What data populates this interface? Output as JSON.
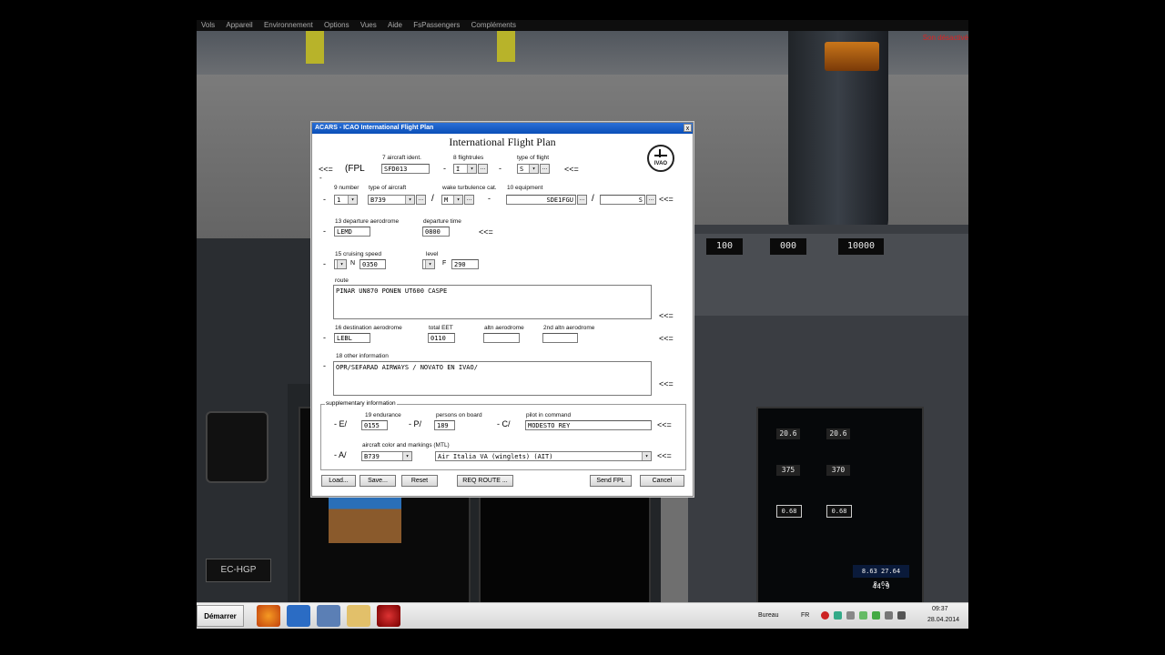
{
  "sim": {
    "menu": [
      "Vols",
      "Appareil",
      "Environnement",
      "Options",
      "Vues",
      "Aide",
      "FsPassengers",
      "Compléments"
    ],
    "warning": "Son désactivé",
    "mcp": {
      "course": "100",
      "heading": "000",
      "altitude": "10000"
    },
    "registration": "EC-HGP",
    "eicas": {
      "n1_left": "20.6",
      "n1_right": "20.6",
      "egt_left": "375",
      "egt_right": "370",
      "ff_left": "0.68",
      "ff_right": "0.68",
      "fuel": "8.63 27.64 8.63",
      "total": "44.9"
    }
  },
  "dialog": {
    "title": "ACARS - ICAO International Flight Plan",
    "close": "x",
    "heading": "International Flight Plan",
    "logo": "IVAO",
    "row1": {
      "arrows_left": "<<=",
      "fpl_prefix": "(FPL",
      "ident_label": "7 aircraft ident.",
      "ident_value": "SFD013",
      "dash1": "-",
      "rules_label": "8 flightrules",
      "rules_value": "I",
      "dash2": "-",
      "type_label": "type of flight",
      "type_value": "S",
      "arrows_right": "<<=",
      "lead_dash": "-"
    },
    "row2": {
      "dash": "-",
      "number_label": "9 number",
      "number_value": "1",
      "actype_label": "type of aircraft",
      "actype_value": "B739",
      "slash1": "/",
      "wake_label": "wake turbulence cat.",
      "wake_value": "M",
      "dash2": "-",
      "equip_label": "10 equipment",
      "equip_value": "SDE1FGU",
      "slash2": "/",
      "equip2_value": "S",
      "arrows_right": "<<="
    },
    "row3": {
      "dash": "-",
      "dep_label": "13 departure aerodrome",
      "dep_value": "LEMD",
      "time_label": "departure time",
      "time_value": "0800",
      "arrows_right": "<<="
    },
    "row4": {
      "dash": "-",
      "speed_label": "15 cruising speed",
      "speed_unit": "N",
      "speed_value": "0350",
      "level_label": "level",
      "level_unit": "F",
      "level_value": "290"
    },
    "route": {
      "label": "route",
      "value": "PINAR UN870 PONEN UT600 CASPE",
      "arrows_right": "<<="
    },
    "row6": {
      "dash": "-",
      "dest_label": "16 destination aerodrome",
      "dest_value": "LEBL",
      "eet_label": "total EET",
      "eet_value": "0110",
      "altn_label": "altn aerodrome",
      "altn_value": "",
      "altn2_label": "2nd altn aerodrome",
      "altn2_value": "",
      "arrows_right": "<<="
    },
    "other": {
      "dash": "-",
      "label": "18 other information",
      "value": "OPR/SEFARAD AIRWAYS / NOVATO EN IVAO/",
      "arrows_right": "<<="
    },
    "supplementary": {
      "title": "supplementary information",
      "endurance_prefix": "- E/",
      "endurance_label": "19 endurance",
      "endurance_value": "0155",
      "persons_prefix": "- P/",
      "persons_label": "persons on board",
      "persons_value": "189",
      "pilot_prefix": "- C/",
      "pilot_label": "pilot in command",
      "pilot_value": "MODESTO REY",
      "arrows_1": "<<=",
      "color_prefix": "- A/",
      "color_label": "aircraft color and markings (MTL)",
      "color_value": "B739",
      "mtl_value": "Air Italia VA (winglets) (AIT)",
      "arrows_2": "<<="
    },
    "buttons": {
      "load": "Load...",
      "save": "Save...",
      "reset": "Reset",
      "req_route": "REQ ROUTE ...",
      "send": "Send FPL",
      "cancel": "Cancel"
    },
    "ellipsis": "..."
  },
  "taskbar": {
    "start": "Démarrer",
    "bureau": "Bureau",
    "lang": "FR",
    "time": "09:37",
    "date": "28.04.2014"
  }
}
